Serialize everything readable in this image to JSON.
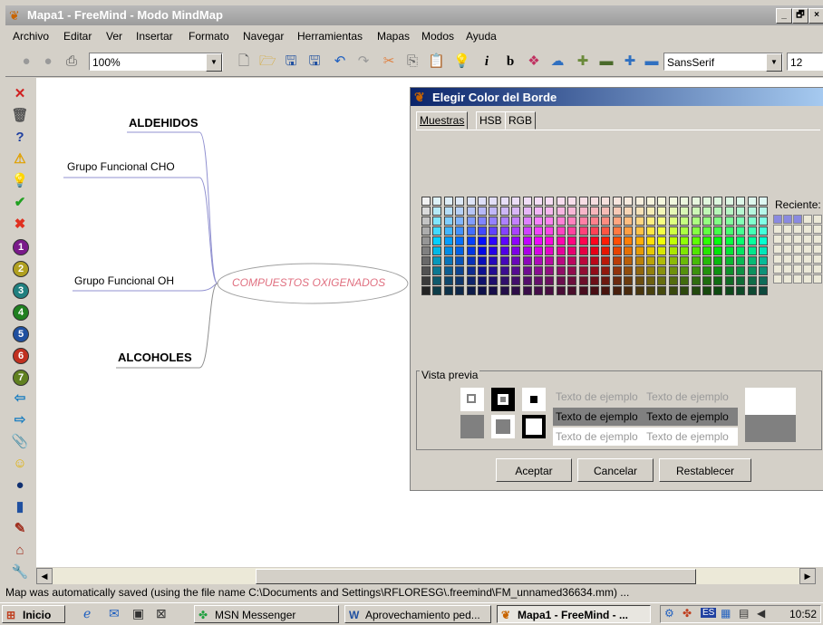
{
  "window": {
    "title": "Mapa1 - FreeMind - Modo MindMap",
    "min_label": "_",
    "max_label": "🗗",
    "close_label": "×"
  },
  "menu": [
    "Archivo",
    "Editar",
    "Ver",
    "Insertar",
    "Formato",
    "Navegar",
    "Herramientas",
    "Mapas",
    "Modos",
    "Ayuda"
  ],
  "toolbar": {
    "zoom_value": "100%",
    "font_value": "SansSerif",
    "size_value": "12",
    "italic_label": "i",
    "bold_label": "b"
  },
  "left_icons": {
    "numbers": [
      "1",
      "2",
      "3",
      "4",
      "5",
      "6",
      "7"
    ]
  },
  "mindmap": {
    "center": "COMPUESTOS OXIGENADOS",
    "nodes": [
      "ALDEHIDOS",
      "Grupo Funcional  CHO",
      "Grupo Funcional  OH",
      "ALCOHOLES"
    ]
  },
  "dialog": {
    "title": "Elegir Color del Borde",
    "tabs": [
      "Muestras",
      "HSB",
      "RGB"
    ],
    "recent_label": "Reciente:",
    "preview_label": "Vista previa",
    "sample_text": "Texto de ejemplo",
    "buttons": {
      "accept": "Aceptar",
      "cancel": "Cancelar",
      "reset": "Restablecer"
    }
  },
  "status": "Map was automatically saved (using the file name C:\\Documents and Settings\\RFLORESG\\.freemind\\FM_unnamed36634.mm) ...",
  "taskbar": {
    "start": "Inicio",
    "tasks": [
      "MSN Messenger",
      "Aprovechamiento ped...",
      "Mapa1 - FreeMind - ..."
    ],
    "lang": "ES",
    "clock": "10:52"
  }
}
